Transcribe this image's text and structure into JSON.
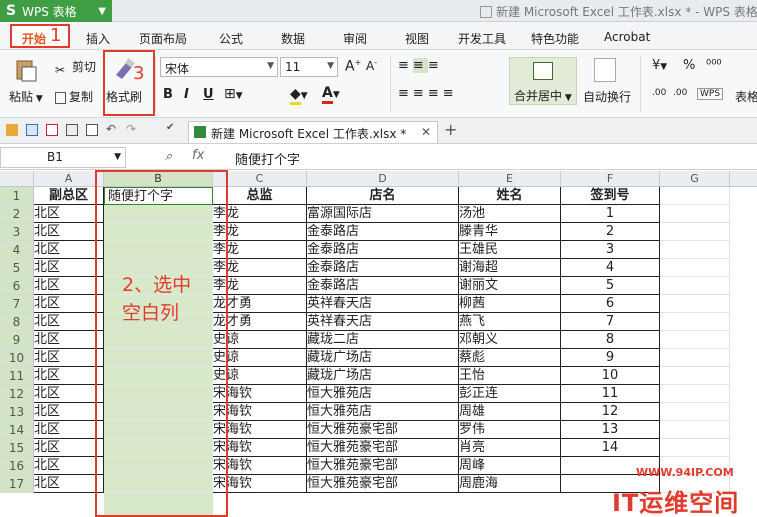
{
  "app": {
    "name": "WPS 表格",
    "logo_glyph": "S",
    "window_title": "新建 Microsoft Excel 工作表.xlsx * - WPS 表格"
  },
  "menu": {
    "tabs": [
      "开始",
      "插入",
      "页面布局",
      "公式",
      "数据",
      "审阅",
      "视图",
      "开发工具",
      "特色功能",
      "Acrobat"
    ],
    "active_tab": "开始"
  },
  "ribbon": {
    "paste": "粘贴",
    "cut": "剪切",
    "copy": "复制",
    "format_painter": "格式刷",
    "font_name": "宋体",
    "font_size": "11",
    "bold": "B",
    "italic": "I",
    "underline": "U",
    "merge_center": "合并居中",
    "wrap_text": "自动换行",
    "percent": "%",
    "table_style": "表格"
  },
  "document_tab": {
    "title": "新建 Microsoft Excel 工作表.xlsx *"
  },
  "formula_bar": {
    "cell_ref": "B1",
    "fx": "fx",
    "value": "随便打个字"
  },
  "sheet": {
    "columns": [
      "A",
      "B",
      "C",
      "D",
      "E",
      "F",
      "G"
    ],
    "selected_column": "B",
    "headers": {
      "A": "副总区",
      "B": "随便打个字",
      "C": "总监",
      "D": "店名",
      "E": "姓名",
      "F": "签到号"
    },
    "rows": [
      {
        "n": "1"
      },
      {
        "n": "2",
        "A": "北区",
        "C": "李龙",
        "D": "富源国际店",
        "E": "汤池",
        "F": "1"
      },
      {
        "n": "3",
        "A": "北区",
        "C": "李龙",
        "D": "金泰路店",
        "E": "滕青华",
        "F": "2"
      },
      {
        "n": "4",
        "A": "北区",
        "C": "李龙",
        "D": "金泰路店",
        "E": "王雄民",
        "F": "3"
      },
      {
        "n": "5",
        "A": "北区",
        "C": "李龙",
        "D": "金泰路店",
        "E": "谢海超",
        "F": "4"
      },
      {
        "n": "6",
        "A": "北区",
        "C": "李龙",
        "D": "金泰路店",
        "E": "谢丽文",
        "F": "5"
      },
      {
        "n": "7",
        "A": "北区",
        "C": "龙才勇",
        "D": "英祥春天店",
        "E": "柳茜",
        "F": "6"
      },
      {
        "n": "8",
        "A": "北区",
        "C": "龙才勇",
        "D": "英祥春天店",
        "E": "燕飞",
        "F": "7"
      },
      {
        "n": "9",
        "A": "北区",
        "C": "史谅",
        "D": "藏珑二店",
        "E": "邓朝义",
        "F": "8"
      },
      {
        "n": "10",
        "A": "北区",
        "C": "史谅",
        "D": "藏珑广场店",
        "E": "蔡彪",
        "F": "9"
      },
      {
        "n": "11",
        "A": "北区",
        "C": "史谅",
        "D": "藏珑广场店",
        "E": "王怡",
        "F": "10"
      },
      {
        "n": "12",
        "A": "北区",
        "C": "宋海钦",
        "D": "恒大雅苑店",
        "E": "彭正连",
        "F": "11"
      },
      {
        "n": "13",
        "A": "北区",
        "C": "宋海钦",
        "D": "恒大雅苑店",
        "E": "周雄",
        "F": "12"
      },
      {
        "n": "14",
        "A": "北区",
        "C": "宋海钦",
        "D": "恒大雅苑豪宅部",
        "E": "罗伟",
        "F": "13"
      },
      {
        "n": "15",
        "A": "北区",
        "C": "宋海钦",
        "D": "恒大雅苑豪宅部",
        "E": "肖亮",
        "F": "14"
      },
      {
        "n": "16",
        "A": "北区",
        "C": "宋海钦",
        "D": "恒大雅苑豪宅部",
        "E": "周峰",
        "F": ""
      },
      {
        "n": "17",
        "A": "北区",
        "C": "宋海钦",
        "D": "恒大雅苑豪宅部",
        "E": "周鹿海",
        "F": ""
      }
    ]
  },
  "annotations": {
    "step1": "1",
    "step2_line1": "2、选中",
    "step2_line2": "空白列",
    "step3": "3"
  },
  "watermark": {
    "url": "WWW.94IP.COM",
    "brand": "IT运维空间"
  },
  "colors": {
    "wps_green": "#3f9e44",
    "annotation_red": "#e23b2e",
    "selection_green": "#d8e9c9"
  }
}
